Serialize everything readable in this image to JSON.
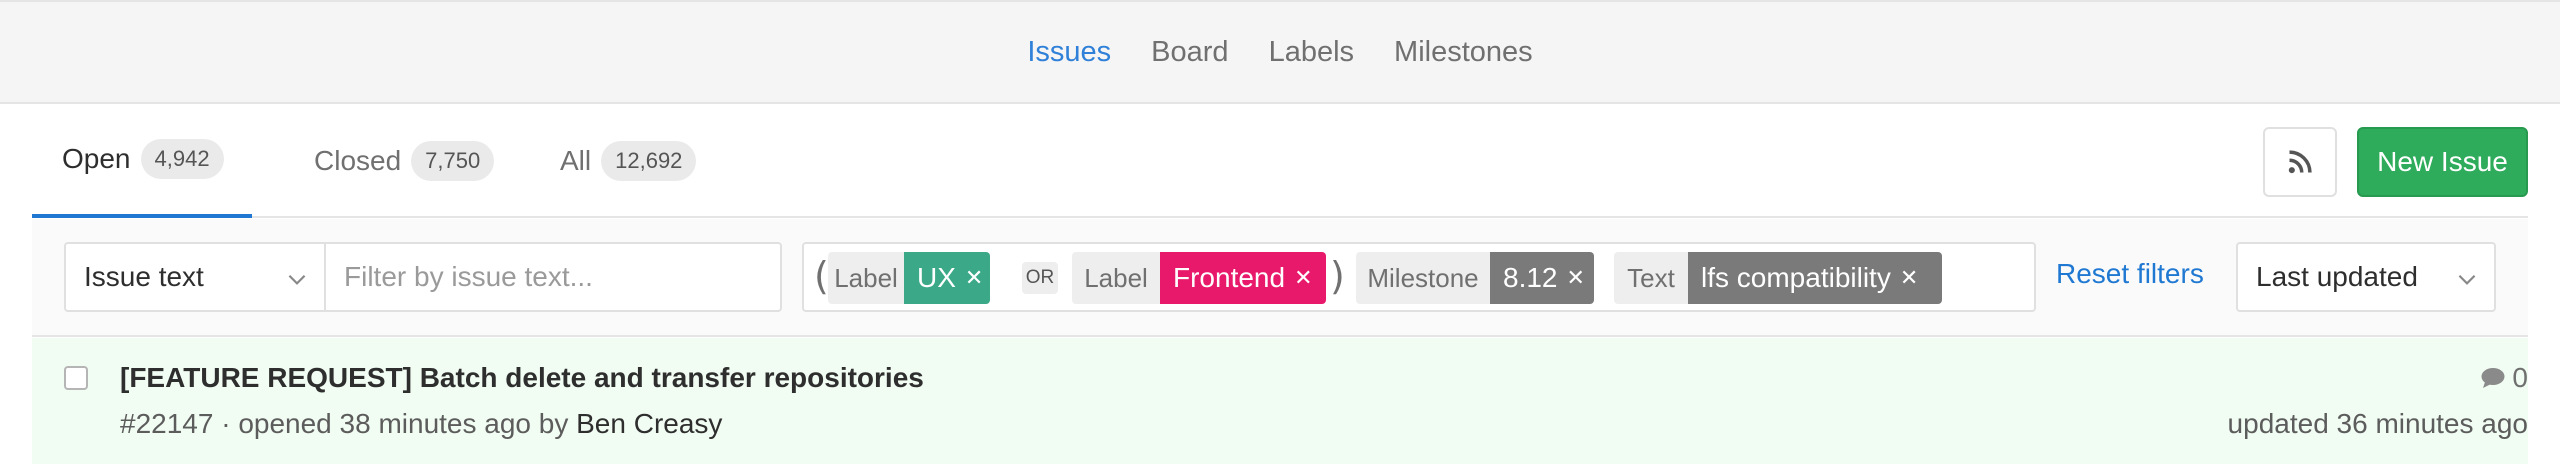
{
  "subnav": {
    "items": [
      {
        "label": "Issues",
        "active": true
      },
      {
        "label": "Board",
        "active": false
      },
      {
        "label": "Labels",
        "active": false
      },
      {
        "label": "Milestones",
        "active": false
      }
    ]
  },
  "tabs": [
    {
      "label": "Open",
      "count": "4,942",
      "active": true
    },
    {
      "label": "Closed",
      "count": "7,750",
      "active": false
    },
    {
      "label": "All",
      "count": "12,692",
      "active": false
    }
  ],
  "actions": {
    "rss_icon": "rss-icon",
    "new_issue_label": "New Issue"
  },
  "filters": {
    "search_type": "Issue text",
    "search_placeholder": "Filter by issue text...",
    "tokens": {
      "open_paren": "(",
      "close_paren": ")",
      "or_label": "OR",
      "label1": {
        "name": "Label",
        "value": "UX",
        "color": "#3ba987"
      },
      "label2": {
        "name": "Label",
        "value": "Frontend",
        "color": "#e8196b"
      },
      "milestone": {
        "name": "Milestone",
        "value": "8.12",
        "color": "#7a7a7a"
      },
      "text": {
        "name": "Text",
        "value": "lfs compatibility",
        "color": "#7a7a7a"
      }
    },
    "reset_label": "Reset filters",
    "sort_value": "Last updated"
  },
  "issues": [
    {
      "title": "[FEATURE REQUEST] Batch delete and transfer repositories",
      "meta_prefix": "#22147 · opened 38 minutes ago by",
      "author": "Ben Creasy",
      "comments": "0",
      "updated": "updated 36 minutes ago"
    }
  ],
  "colors": {
    "accent": "#1f78d1",
    "new_issue": "#2eab5b",
    "issue_row_bg": "#f1fcf3"
  }
}
